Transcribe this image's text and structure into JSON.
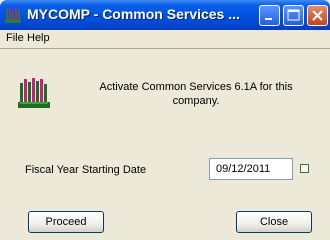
{
  "window": {
    "title": "MYCOMP - Common Services ..."
  },
  "menu": {
    "items": [
      {
        "label": "File"
      },
      {
        "label": "Help"
      }
    ]
  },
  "main": {
    "message": "Activate Common Services 6.1A for this company.",
    "fiscal_label": "Fiscal Year Starting Date",
    "fiscal_date": "09/12/2011"
  },
  "buttons": {
    "proceed_label": "Proceed",
    "close_label": "Close"
  },
  "icons": {
    "app": "sage-bars-icon",
    "calendar": "calendar-icon"
  },
  "colors": {
    "titlebar": "#0055e5",
    "close_button": "#c4431d",
    "dialog_bg": "#ece9d8"
  }
}
